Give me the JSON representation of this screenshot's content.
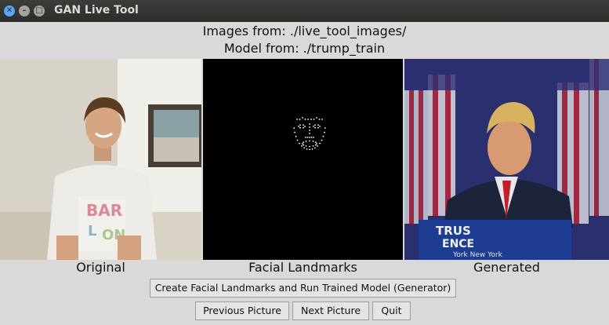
{
  "window": {
    "title": "GAN Live Tool",
    "controls": [
      "close-icon",
      "minimize-icon",
      "maximize-icon"
    ]
  },
  "header": {
    "images_line": "Images from: ./live_tool_images/",
    "model_line": "Model from: ./trump_train"
  },
  "panels": {
    "original": {
      "caption": "Original"
    },
    "landmarks": {
      "caption": "Facial Landmarks"
    },
    "generated": {
      "caption": "Generated",
      "podium_line1": "TRUS",
      "podium_line2": "ENCE",
      "podium_line3": "York New York"
    }
  },
  "buttons": {
    "run": "Create Facial Landmarks and Run Trained Model (Generator)",
    "previous": "Previous Picture",
    "next": "Next Picture",
    "quit": "Quit"
  },
  "colors": {
    "titlebar": "#2f2f2d",
    "close_button": "#5aa6f0",
    "window_bg": "#d9d9d9",
    "landmark_bg": "#000000",
    "landmark_points": "#ffffff"
  }
}
